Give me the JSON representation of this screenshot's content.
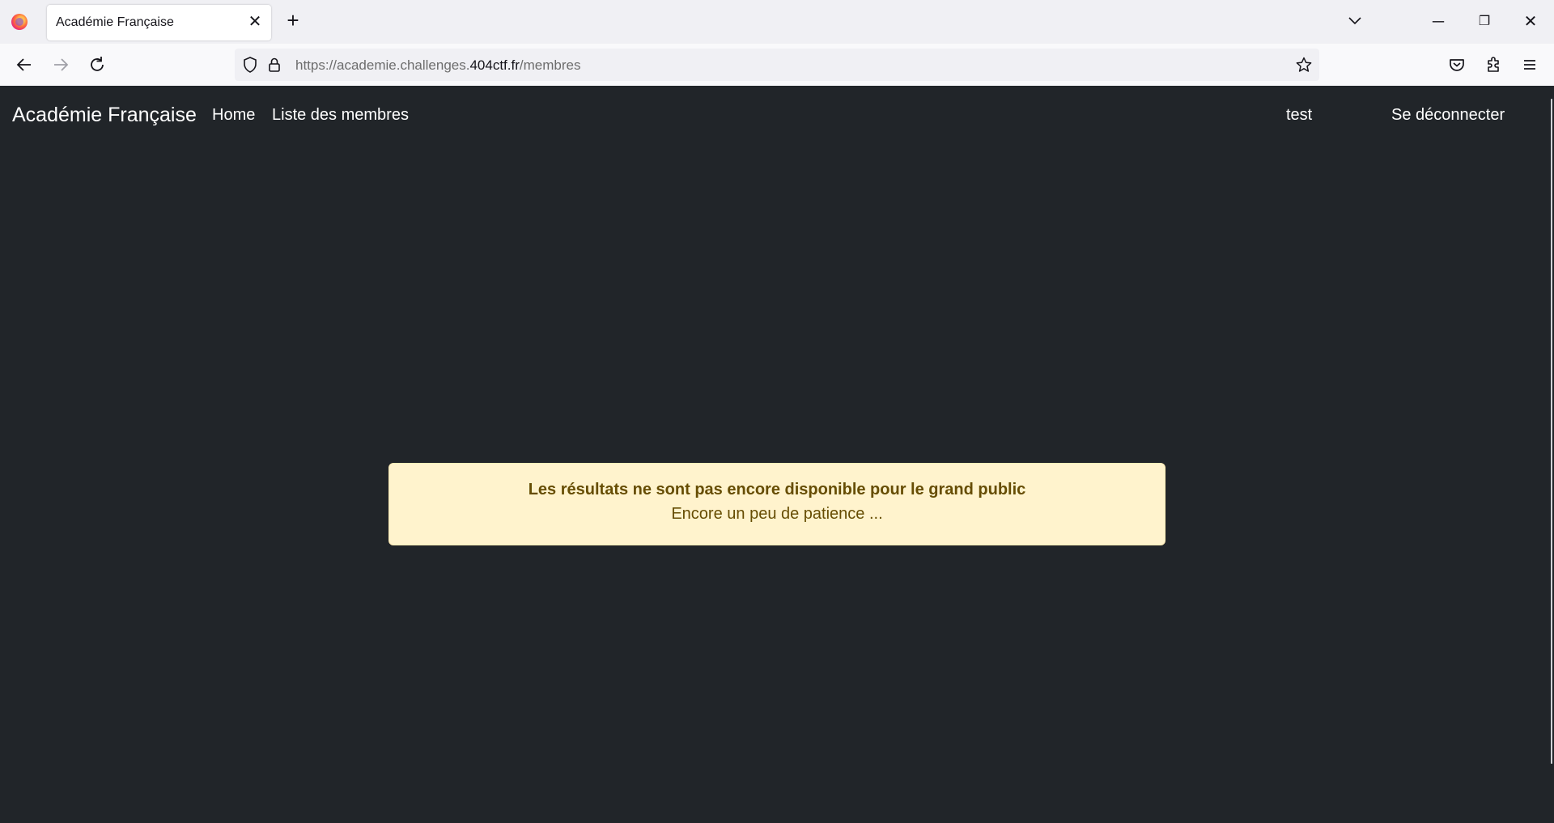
{
  "browser": {
    "tab_title": "Académie Française",
    "tab_close": "✕",
    "new_tab": "+",
    "url_prefix": "https://academie.challenges.",
    "url_host": "404ctf.fr",
    "url_path": "/membres",
    "window_controls": {
      "minimize": "─",
      "restore": "❐",
      "close": "✕"
    },
    "icons": [
      "firefox-logo",
      "tab-list-chevron",
      "back-arrow",
      "forward-arrow",
      "reload",
      "shield",
      "lock",
      "star",
      "pocket",
      "extensions",
      "menu"
    ]
  },
  "site": {
    "brand": "Académie Française",
    "nav": {
      "home": "Home",
      "members": "Liste des membres"
    },
    "user": "test",
    "logout": "Se déconnecter"
  },
  "alert": {
    "title": "Les résultats ne sont pas encore disponible pour le grand public",
    "message": "Encore un peu de patience ..."
  },
  "colors": {
    "page_bg": "#212529",
    "alert_bg": "#fff3cd",
    "alert_text": "#664d03"
  }
}
